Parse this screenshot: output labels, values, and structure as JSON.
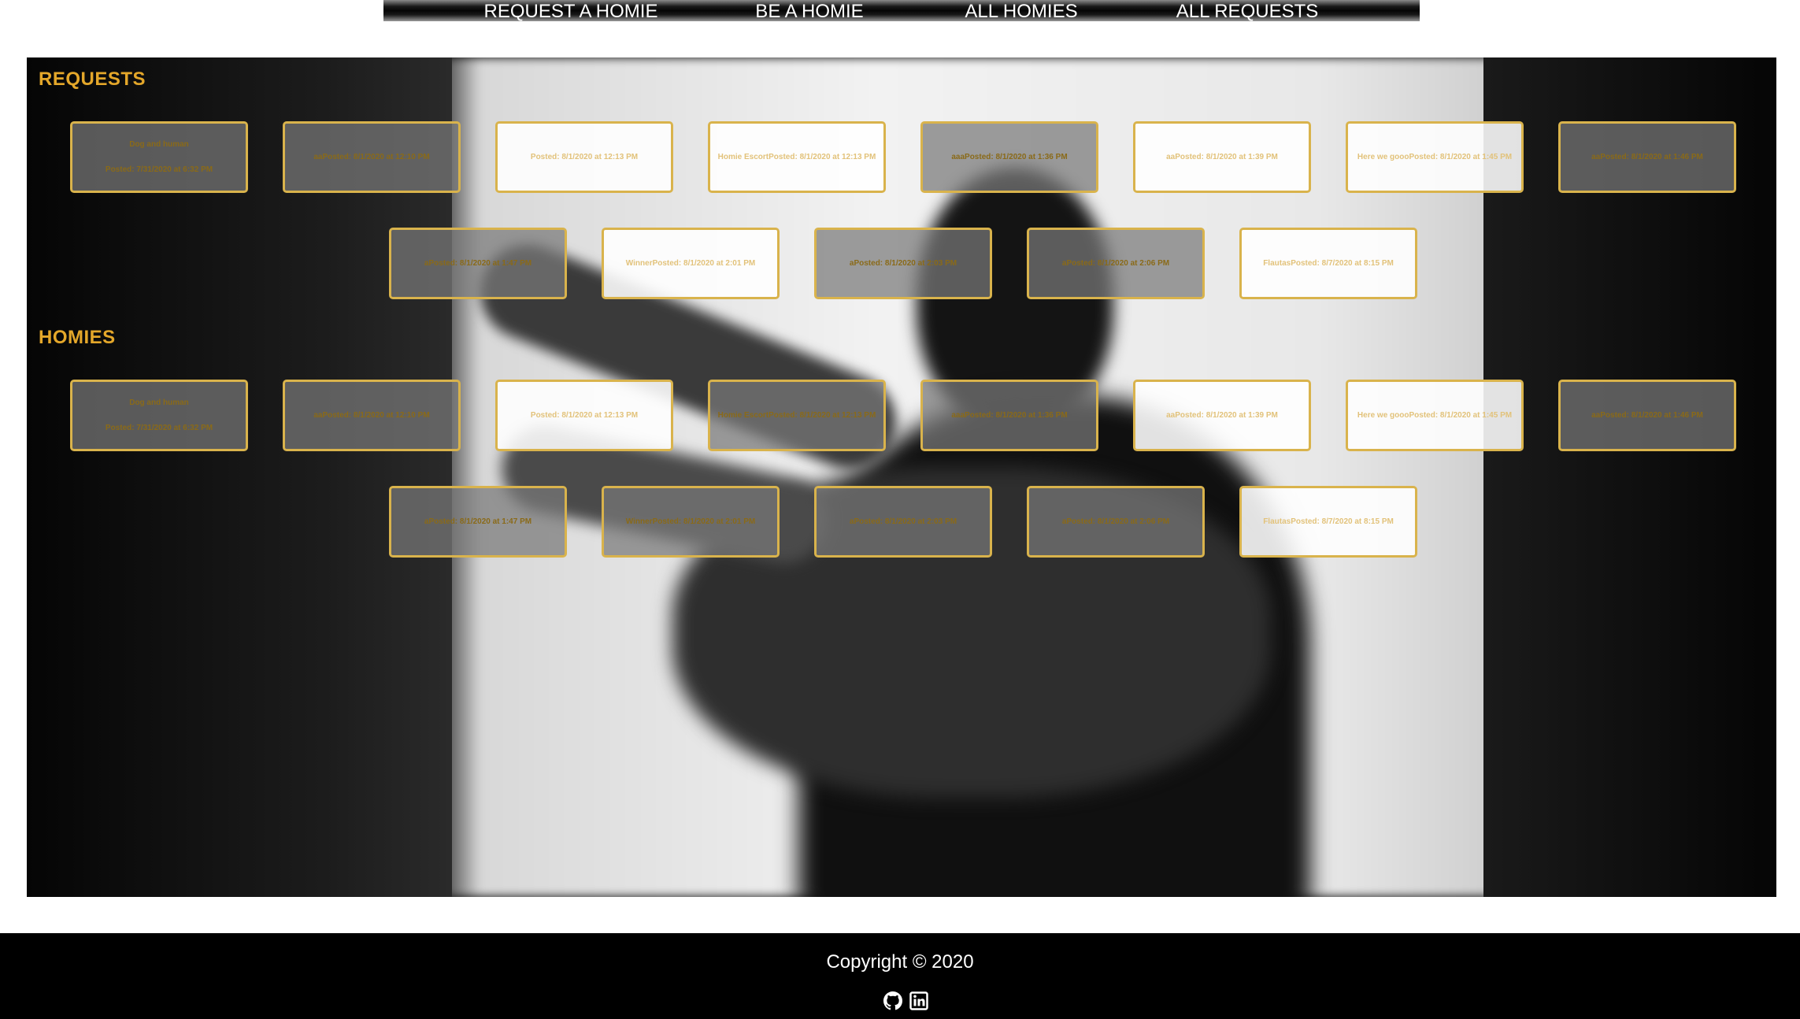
{
  "nav": {
    "items": [
      {
        "label": "REQUEST A HOMIE"
      },
      {
        "label": "BE A HOMIE"
      },
      {
        "label": "ALL HOMIES"
      },
      {
        "label": "ALL REQUESTS"
      }
    ]
  },
  "colors": {
    "accent": "#e4a72a",
    "card_border": "#d9b34c",
    "footer_bg": "#000000"
  },
  "sections": [
    {
      "title": "REQUESTS",
      "cards": [
        {
          "lines": [
            "Dog and human",
            "Posted: 7/31/2020 at 6:32 PM"
          ]
        },
        {
          "lines": [
            "aaPosted: 8/1/2020 at 12:10 PM"
          ]
        },
        {
          "lines": [
            "Posted: 8/1/2020 at 12:13 PM"
          ]
        },
        {
          "lines": [
            "Homie EscortPosted: 8/1/2020 at 12:13 PM"
          ]
        },
        {
          "lines": [
            "aaaPosted: 8/1/2020 at 1:36 PM"
          ]
        },
        {
          "lines": [
            "aaPosted: 8/1/2020 at 1:39 PM"
          ]
        },
        {
          "lines": [
            "Here we goooPosted: 8/1/2020 at 1:45 PM"
          ]
        },
        {
          "lines": [
            "aaPosted: 8/1/2020 at 1:46 PM"
          ]
        },
        {
          "lines": [
            "aPosted: 8/1/2020 at 1:47 PM"
          ]
        },
        {
          "lines": [
            "WinnerPosted: 8/1/2020 at 2:01 PM"
          ]
        },
        {
          "lines": [
            "aPosted: 8/1/2020 at 2:03 PM"
          ]
        },
        {
          "lines": [
            "aPosted: 8/1/2020 at 2:06 PM"
          ]
        },
        {
          "lines": [
            "FlautasPosted: 8/7/2020 at 8:15 PM"
          ]
        }
      ]
    },
    {
      "title": "HOMIES",
      "cards": [
        {
          "lines": [
            "Dog and human",
            "Posted: 7/31/2020 at 6:32 PM"
          ]
        },
        {
          "lines": [
            "aaPosted: 8/1/2020 at 12:10 PM"
          ]
        },
        {
          "lines": [
            "Posted: 8/1/2020 at 12:13 PM"
          ]
        },
        {
          "lines": [
            "Homie EscortPosted: 8/1/2020 at 12:13 PM"
          ]
        },
        {
          "lines": [
            "aaaPosted: 8/1/2020 at 1:36 PM"
          ]
        },
        {
          "lines": [
            "aaPosted: 8/1/2020 at 1:39 PM"
          ]
        },
        {
          "lines": [
            "Here we goooPosted: 8/1/2020 at 1:45 PM"
          ]
        },
        {
          "lines": [
            "aaPosted: 8/1/2020 at 1:46 PM"
          ]
        },
        {
          "lines": [
            "aPosted: 8/1/2020 at 1:47 PM"
          ]
        },
        {
          "lines": [
            "WinnerPosted: 8/1/2020 at 2:01 PM"
          ]
        },
        {
          "lines": [
            "aPosted: 8/1/2020 at 2:03 PM"
          ]
        },
        {
          "lines": [
            "aPosted: 8/1/2020 at 2:06 PM"
          ]
        },
        {
          "lines": [
            "FlautasPosted: 8/7/2020 at 8:15 PM"
          ]
        }
      ]
    }
  ],
  "footer": {
    "copyright": "Copyright © 2020",
    "icons": [
      "github-icon",
      "linkedin-icon"
    ]
  }
}
